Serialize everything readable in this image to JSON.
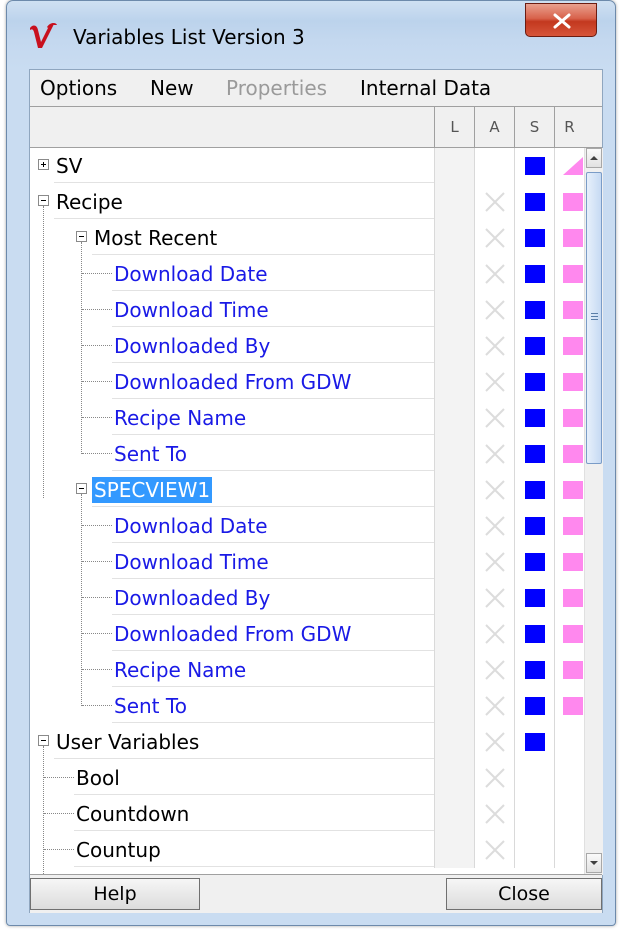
{
  "window": {
    "title": "Variables List Version 3"
  },
  "menu": [
    {
      "label": "Options",
      "enabled": true
    },
    {
      "label": "New",
      "enabled": true
    },
    {
      "label": "Properties",
      "enabled": false
    },
    {
      "label": "Internal Data",
      "enabled": true
    }
  ],
  "columns": {
    "l": "L",
    "a": "A",
    "s": "S",
    "r": "R"
  },
  "tree": [
    {
      "label": "SV",
      "type": "node",
      "level": 0,
      "expander": "plus",
      "l": false,
      "a": false,
      "s": true,
      "r": "partial"
    },
    {
      "label": "Recipe",
      "type": "node",
      "level": 0,
      "expander": "minus",
      "a": true,
      "s": true,
      "r": true
    },
    {
      "label": "Most Recent",
      "type": "node",
      "level": 1,
      "expander": "minus",
      "a": true,
      "s": true,
      "r": true
    },
    {
      "label": "Download Date",
      "type": "leaf",
      "level": 2,
      "a": true,
      "s": true,
      "r": true
    },
    {
      "label": "Download Time",
      "type": "leaf",
      "level": 2,
      "a": true,
      "s": true,
      "r": true
    },
    {
      "label": "Downloaded By",
      "type": "leaf",
      "level": 2,
      "a": true,
      "s": true,
      "r": true
    },
    {
      "label": "Downloaded From GDW",
      "type": "leaf",
      "level": 2,
      "a": true,
      "s": true,
      "r": true
    },
    {
      "label": "Recipe Name",
      "type": "leaf",
      "level": 2,
      "a": true,
      "s": true,
      "r": true
    },
    {
      "label": "Sent To",
      "type": "leaf",
      "level": 2,
      "a": true,
      "s": true,
      "r": true
    },
    {
      "label": "SPECVIEW1",
      "type": "node",
      "level": 1,
      "expander": "minus",
      "selected": true,
      "a": true,
      "s": true,
      "r": true
    },
    {
      "label": "Download Date",
      "type": "leaf",
      "level": 2,
      "a": true,
      "s": true,
      "r": true
    },
    {
      "label": "Download Time",
      "type": "leaf",
      "level": 2,
      "a": true,
      "s": true,
      "r": true
    },
    {
      "label": "Downloaded By",
      "type": "leaf",
      "level": 2,
      "a": true,
      "s": true,
      "r": true
    },
    {
      "label": "Downloaded From GDW",
      "type": "leaf",
      "level": 2,
      "a": true,
      "s": true,
      "r": true
    },
    {
      "label": "Recipe Name",
      "type": "leaf",
      "level": 2,
      "a": true,
      "s": true,
      "r": true
    },
    {
      "label": "Sent To",
      "type": "leaf",
      "level": 2,
      "a": true,
      "s": true,
      "r": true
    },
    {
      "label": "User Variables",
      "type": "node",
      "level": 0,
      "expander": "minus",
      "a": true,
      "s": true,
      "r": false
    },
    {
      "label": "Bool",
      "type": "child",
      "level": 1,
      "a": true,
      "s": false,
      "r": false
    },
    {
      "label": "Countdown",
      "type": "child",
      "level": 1,
      "a": true,
      "s": false,
      "r": false
    },
    {
      "label": "Countup",
      "type": "child",
      "level": 1,
      "a": true,
      "s": false,
      "r": false
    }
  ],
  "buttons": {
    "help": "Help",
    "close": "Close"
  },
  "colors": {
    "selection": "#3399ff",
    "leaf_text": "#1a1ae6",
    "s_marker": "#0000ff",
    "r_marker": "#ff88ee",
    "close_button": "#c3381f"
  },
  "icons": {
    "app": "v-logo-icon",
    "window_close": "close-icon",
    "expand": "plus-box-icon",
    "collapse": "minus-box-icon",
    "disabled": "x-mark-icon"
  }
}
